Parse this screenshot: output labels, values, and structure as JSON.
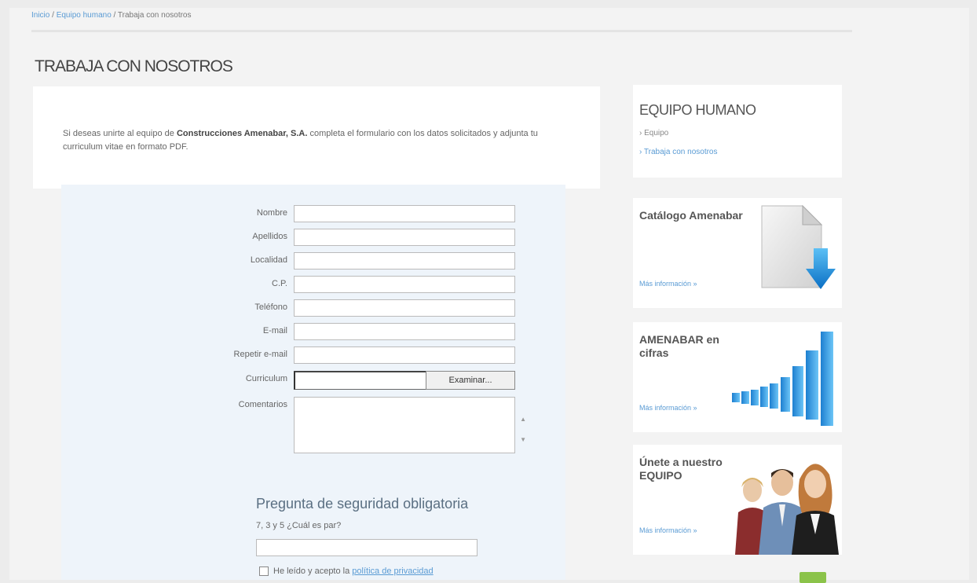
{
  "breadcrumb": {
    "item1": "Inicio",
    "item2": "Equipo humano",
    "current": "Trabaja con nosotros"
  },
  "page_title": "TRABAJA CON NOSOTROS",
  "intro": {
    "before": "Si deseas unirte al equipo de ",
    "company": "Construcciones Amenabar, S.A.",
    "after": " completa el formulario con los datos solicitados y adjunta tu curriculum vitae en formato PDF."
  },
  "form": {
    "fields": [
      {
        "label": "Nombre"
      },
      {
        "label": "Apellidos"
      },
      {
        "label": "Localidad"
      },
      {
        "label": "C.P."
      },
      {
        "label": "Teléfono"
      },
      {
        "label": "E-mail"
      },
      {
        "label": "Repetir e-mail"
      }
    ],
    "cv_label": "Curriculum",
    "browse_label": "Examinar...",
    "comments_label": "Comentarios",
    "security_title": "Pregunta de seguridad obligatoria",
    "security_question": "7, 3 y 5 ¿Cuál es par?",
    "accept_text": "He leído y acepto la ",
    "privacy_link": "política de privacidad"
  },
  "sidebar": {
    "equipo": {
      "title": "EQUIPO HUMANO",
      "link1": "› Equipo",
      "link2": "› Trabaja con nosotros"
    },
    "promos": [
      {
        "title": "Catálogo Amenabar",
        "more": "Más información »"
      },
      {
        "title": "AMENABAR en cifras",
        "more": "Más información »"
      },
      {
        "title": "Únete a nuestro EQUIPO",
        "more": "Más información »"
      }
    ]
  },
  "colors": {
    "link": "#5a9bd4",
    "form_bg": "#eef4fa",
    "arrow": "#1e88d8",
    "accent_green": "#8bc34a"
  }
}
